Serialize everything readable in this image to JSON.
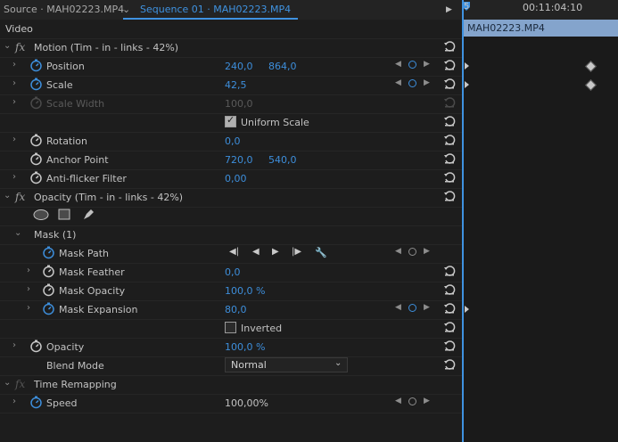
{
  "tabs": {
    "source": "Source · MAH02223.MP4",
    "sequence": "Sequence 01 · MAH02223.MP4",
    "overflow_icon": "triangle-right-icon"
  },
  "timeline": {
    "timecode": "00:11:04:10",
    "clip_label": "MAH02223.MP4",
    "playhead_icon": "playhead-icon"
  },
  "section_video": "Video",
  "motion": {
    "header": "Motion (Tim - in - links - 42%)",
    "position": {
      "label": "Position",
      "x": "240,0",
      "y": "864,0"
    },
    "scale": {
      "label": "Scale",
      "value": "42,5"
    },
    "scale_width": {
      "label": "Scale Width",
      "value": "100,0"
    },
    "uniform_scale": {
      "label": "Uniform Scale",
      "checked": true
    },
    "rotation": {
      "label": "Rotation",
      "value": "0,0"
    },
    "anchor_point": {
      "label": "Anchor Point",
      "x": "720,0",
      "y": "540,0"
    },
    "anti_flicker": {
      "label": "Anti-flicker Filter",
      "value": "0,00"
    }
  },
  "opacity": {
    "header": "Opacity (Tim - in - links - 42%)",
    "mask": {
      "label": "Mask (1)",
      "path": "Mask Path",
      "feather": {
        "label": "Mask Feather",
        "value": "0,0"
      },
      "opacity": {
        "label": "Mask Opacity",
        "value": "100,0 %"
      },
      "expansion": {
        "label": "Mask Expansion",
        "value": "80,0"
      },
      "inverted": {
        "label": "Inverted",
        "checked": false
      }
    },
    "opacity_param": {
      "label": "Opacity",
      "value": "100,0 %"
    },
    "blend_mode": {
      "label": "Blend Mode",
      "value": "Normal"
    }
  },
  "time_remapping": {
    "header": "Time Remapping",
    "speed": {
      "label": "Speed",
      "value": "100,00%"
    }
  },
  "colors": {
    "accent": "#3d8edb",
    "clip": "#84a4cc",
    "panel": "#1d1d1d"
  }
}
